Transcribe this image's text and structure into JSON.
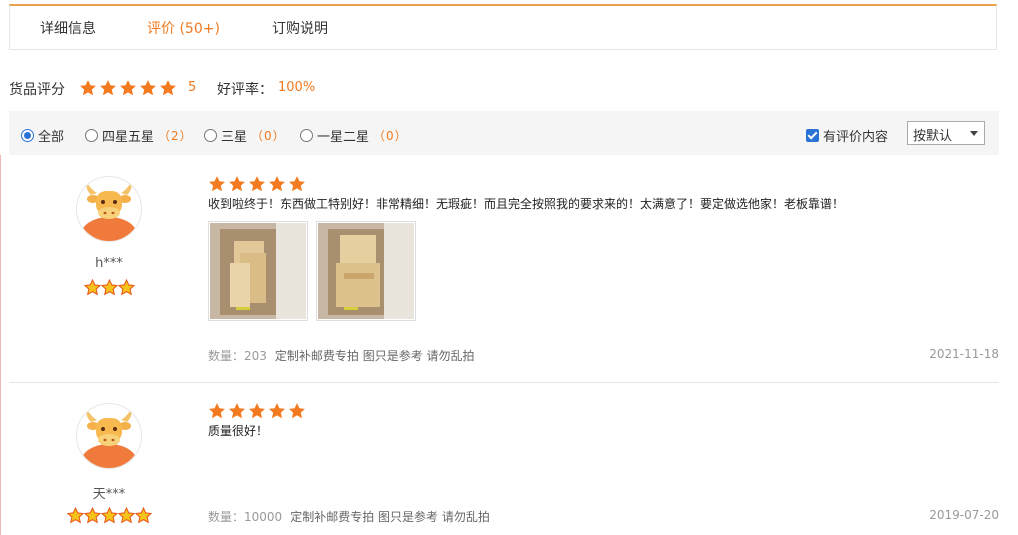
{
  "tabs": [
    {
      "label": "详细信息"
    },
    {
      "label": "评价 (50+)"
    },
    {
      "label": "订购说明"
    }
  ],
  "summary": {
    "score_label": "货品评分",
    "score_value": "5",
    "score_stars": 5,
    "rate_label": "好评率：",
    "rate_value": "100%"
  },
  "filters": {
    "all": {
      "label": "全部",
      "selected": true
    },
    "four_five": {
      "label": "四星五星",
      "count": "（2）"
    },
    "three": {
      "label": "三星",
      "count": "（0）"
    },
    "one_two": {
      "label": "一星二星",
      "count": "（0）"
    },
    "has_content": {
      "label": "有评价内容",
      "checked": true
    },
    "sort": {
      "value": "按默认"
    }
  },
  "reviews": [
    {
      "user": "h***",
      "user_level_stars": 3,
      "rating": 5,
      "text": "收到啦终于！东西做工特别好！非常精细！无瑕疵！而且完全按照我的要求来的！太满意了！要定做选他家！老板靠谱！",
      "images": [
        "photo-1",
        "photo-2"
      ],
      "quantity": "数量：203",
      "note": "定制补邮费专拍 图只是参考 请勿乱拍",
      "date": "2021-11-18"
    },
    {
      "user": "天***",
      "user_level_stars": 5,
      "rating": 5,
      "text": "质量很好！",
      "images": [],
      "quantity": "数量：10000",
      "note": "定制补邮费专拍 图只是参考 请勿乱拍",
      "date": "2019-07-20"
    }
  ],
  "colors": {
    "accent": "#f07a20",
    "star": "#f47a1f",
    "checkbox": "#2b72d6"
  }
}
